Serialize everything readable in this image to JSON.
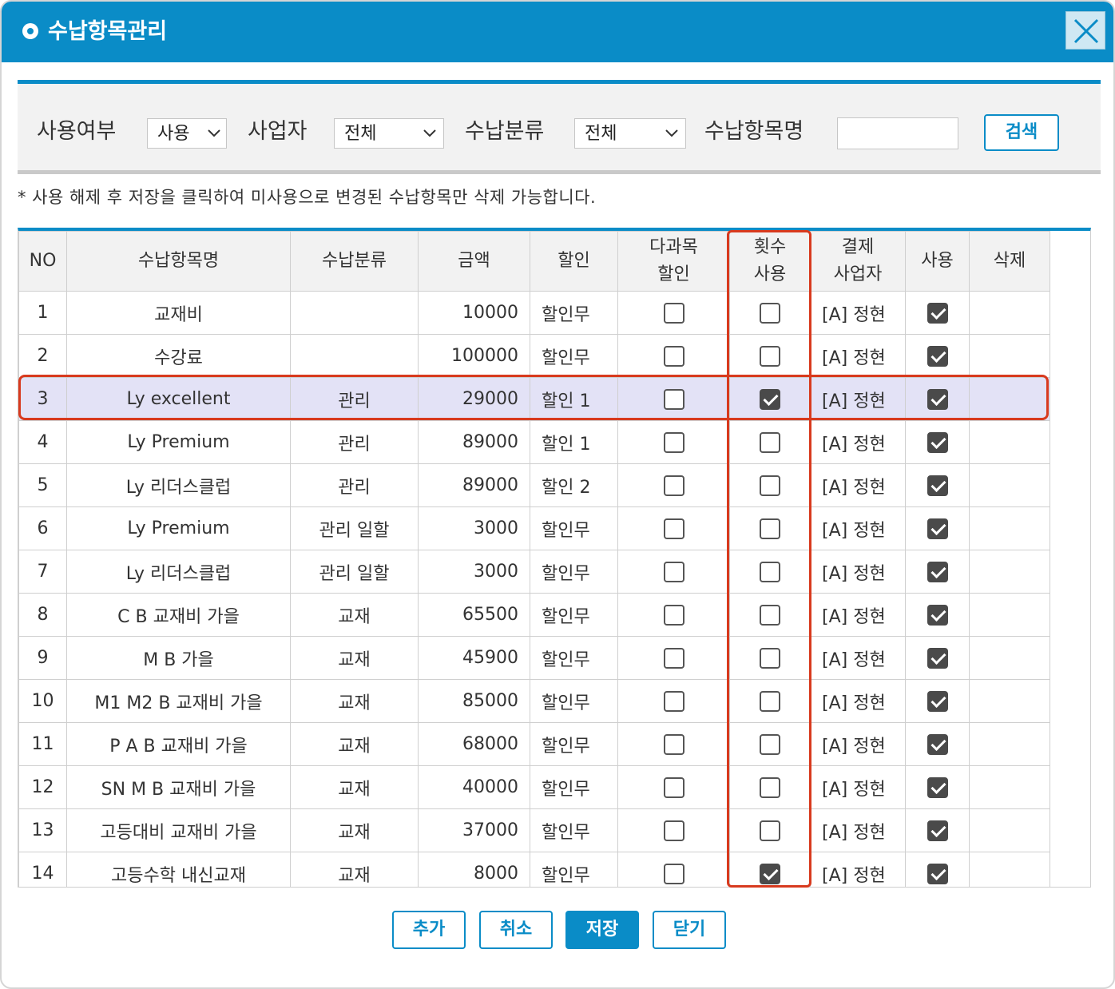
{
  "window": {
    "title": "수납항목관리",
    "close_icon": "close-icon"
  },
  "search": {
    "use_label": "사용여부",
    "use_value": "사용",
    "biz_label": "사업자",
    "biz_value": "전체",
    "category_label": "수납분류",
    "category_value": "전체",
    "item_name_label": "수납항목명",
    "item_name_value": "",
    "search_button": "검색"
  },
  "notice": "* 사용 해제 후 저장을 클릭하여 미사용으로 변경된 수납항목만 삭제 가능합니다.",
  "table": {
    "headers": {
      "no": "NO",
      "name": "수납항목명",
      "category": "수납분류",
      "amount": "금액",
      "discount": "할인",
      "multi_discount_1": "다과목",
      "multi_discount_2": "할인",
      "count_use_1": "횟수",
      "count_use_2": "사용",
      "pay_biz_1": "결제",
      "pay_biz_2": "사업자",
      "use": "사용",
      "delete": "삭제"
    },
    "rows": [
      {
        "no": "1",
        "name": "교재비",
        "category": "",
        "amount": "10000",
        "discount": "할인무",
        "multi": false,
        "count": false,
        "biz": "[A] 정현",
        "use": true
      },
      {
        "no": "2",
        "name": "수강료",
        "category": "",
        "amount": "100000",
        "discount": "할인무",
        "multi": false,
        "count": false,
        "biz": "[A] 정현",
        "use": true
      },
      {
        "no": "3",
        "name": "Ly excellent",
        "category": "관리",
        "amount": "29000",
        "discount": "할인 1",
        "multi": false,
        "count": true,
        "biz": "[A] 정현",
        "use": true
      },
      {
        "no": "4",
        "name": "Ly Premium",
        "category": "관리",
        "amount": "89000",
        "discount": "할인 1",
        "multi": false,
        "count": false,
        "biz": "[A] 정현",
        "use": true
      },
      {
        "no": "5",
        "name": "Ly 리더스클럽",
        "category": "관리",
        "amount": "89000",
        "discount": "할인 2",
        "multi": false,
        "count": false,
        "biz": "[A] 정현",
        "use": true
      },
      {
        "no": "6",
        "name": "Ly Premium",
        "category": "관리 일할",
        "amount": "3000",
        "discount": "할인무",
        "multi": false,
        "count": false,
        "biz": "[A] 정현",
        "use": true
      },
      {
        "no": "7",
        "name": "Ly 리더스클럽",
        "category": "관리 일할",
        "amount": "3000",
        "discount": "할인무",
        "multi": false,
        "count": false,
        "biz": "[A] 정현",
        "use": true
      },
      {
        "no": "8",
        "name": "C B 교재비 가을",
        "category": "교재",
        "amount": "65500",
        "discount": "할인무",
        "multi": false,
        "count": false,
        "biz": "[A] 정현",
        "use": true
      },
      {
        "no": "9",
        "name": "M B 가을",
        "category": "교재",
        "amount": "45900",
        "discount": "할인무",
        "multi": false,
        "count": false,
        "biz": "[A] 정현",
        "use": true
      },
      {
        "no": "10",
        "name": "M1 M2 B 교재비 가을",
        "category": "교재",
        "amount": "85000",
        "discount": "할인무",
        "multi": false,
        "count": false,
        "biz": "[A] 정현",
        "use": true
      },
      {
        "no": "11",
        "name": "P A B 교재비 가을",
        "category": "교재",
        "amount": "68000",
        "discount": "할인무",
        "multi": false,
        "count": false,
        "biz": "[A] 정현",
        "use": true
      },
      {
        "no": "12",
        "name": "SN M B 교재비 가을",
        "category": "교재",
        "amount": "40000",
        "discount": "할인무",
        "multi": false,
        "count": false,
        "biz": "[A] 정현",
        "use": true
      },
      {
        "no": "13",
        "name": "고등대비 교재비 가을",
        "category": "교재",
        "amount": "37000",
        "discount": "할인무",
        "multi": false,
        "count": false,
        "biz": "[A] 정현",
        "use": true
      },
      {
        "no": "14",
        "name": "고등수학 내신교재",
        "category": "교재",
        "amount": "8000",
        "discount": "할인무",
        "multi": false,
        "count": true,
        "biz": "[A] 정현",
        "use": true
      }
    ],
    "selected_row": 3
  },
  "footer": {
    "add": "추가",
    "cancel": "취소",
    "save": "저장",
    "close": "닫기"
  },
  "colors": {
    "accent": "#0a8cc7",
    "highlight": "#d83a1e",
    "selected_row": "#e3e2f6"
  }
}
